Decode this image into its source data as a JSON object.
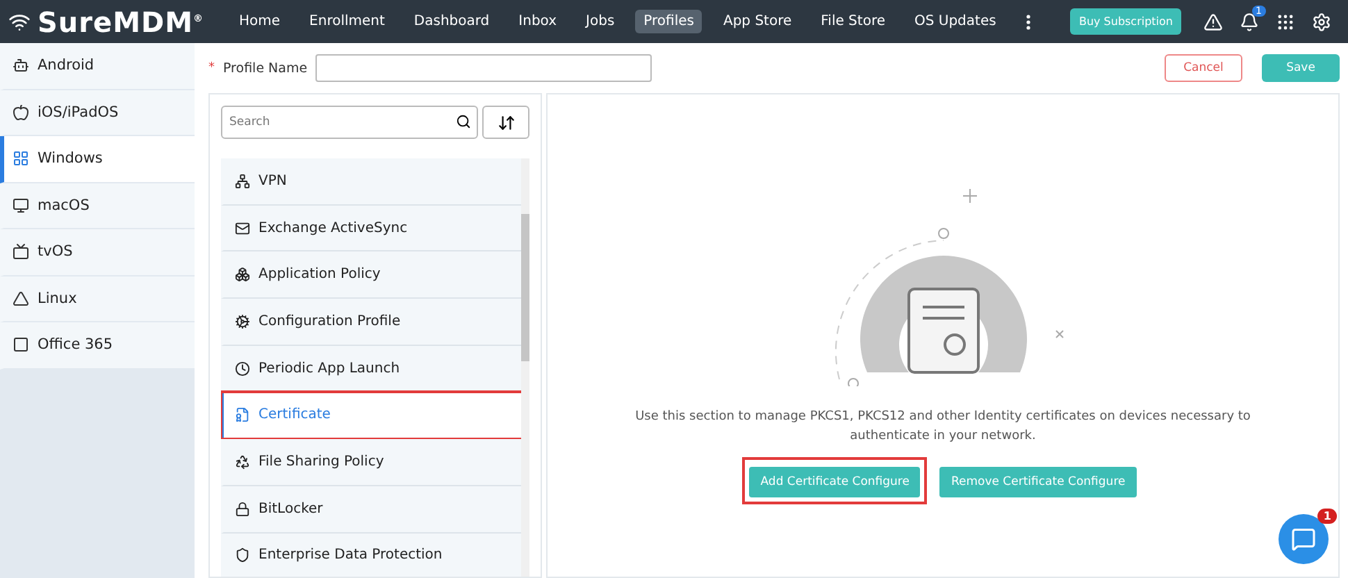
{
  "brand": {
    "name": "SureMDM",
    "mark": "®"
  },
  "nav": [
    {
      "label": "Home",
      "selected": false
    },
    {
      "label": "Enrollment",
      "selected": false
    },
    {
      "label": "Dashboard",
      "selected": false
    },
    {
      "label": "Inbox",
      "selected": false
    },
    {
      "label": "Jobs",
      "selected": false
    },
    {
      "label": "Profiles",
      "selected": true
    },
    {
      "label": "App Store",
      "selected": false
    },
    {
      "label": "File Store",
      "selected": false
    },
    {
      "label": "OS Updates",
      "selected": false
    }
  ],
  "header_actions": {
    "subscription": "Buy Subscription",
    "notification_count": "1"
  },
  "platforms": [
    {
      "label": "Android",
      "kind": "android",
      "selected": false
    },
    {
      "label": "iOS/iPadOS",
      "kind": "apple",
      "selected": false
    },
    {
      "label": "Windows",
      "kind": "windows",
      "selected": true
    },
    {
      "label": "macOS",
      "kind": "monitor",
      "selected": false
    },
    {
      "label": "tvOS",
      "kind": "tv",
      "selected": false
    },
    {
      "label": "Linux",
      "kind": "linux",
      "selected": false
    },
    {
      "label": "Office 365",
      "kind": "office",
      "selected": false
    }
  ],
  "profile_name": {
    "label": "Profile Name",
    "required_mark": "*"
  },
  "buttons": {
    "cancel": "Cancel",
    "save": "Save"
  },
  "search": {
    "placeholder": "Search"
  },
  "policies": [
    {
      "label": "VPN",
      "kind": "vpn",
      "selected": false,
      "highlighted": false
    },
    {
      "label": "Exchange ActiveSync",
      "kind": "mail",
      "selected": false,
      "highlighted": false
    },
    {
      "label": "Application Policy",
      "kind": "apps",
      "selected": false,
      "highlighted": false
    },
    {
      "label": "Configuration Profile",
      "kind": "gear",
      "selected": false,
      "highlighted": false
    },
    {
      "label": "Periodic App Launch",
      "kind": "clock",
      "selected": false,
      "highlighted": false
    },
    {
      "label": "Certificate",
      "kind": "cert",
      "selected": true,
      "highlighted": true
    },
    {
      "label": "File Sharing Policy",
      "kind": "share",
      "selected": false,
      "highlighted": false
    },
    {
      "label": "BitLocker",
      "kind": "lock",
      "selected": false,
      "highlighted": false
    },
    {
      "label": "Enterprise Data Protection",
      "kind": "shield",
      "selected": false,
      "highlighted": false
    }
  ],
  "detail": {
    "description": "Use this section to manage PKCS1, PKCS12 and other Identity certificates on devices necessary to authenticate in your network.",
    "actions": [
      {
        "label": "Add Certificate Configure",
        "highlighted": true
      },
      {
        "label": "Remove Certificate Configure",
        "highlighted": false
      }
    ]
  },
  "chat": {
    "badge": "1"
  }
}
